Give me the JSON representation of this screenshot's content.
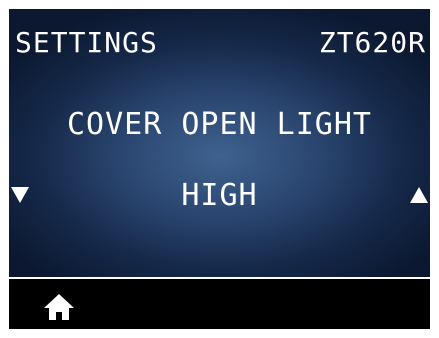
{
  "header": {
    "menu_title": "SETTINGS",
    "model": "ZT620R"
  },
  "setting": {
    "name": "COVER OPEN LIGHT",
    "value": "HIGH"
  },
  "navigation": {
    "decrease_icon": "triangle-down-icon",
    "increase_icon": "triangle-up-icon",
    "home_icon": "home-icon"
  },
  "colors": {
    "background_center": "#3f628e",
    "background_edge": "#0b1830",
    "text": "#ffffff",
    "footer": "#000000"
  }
}
